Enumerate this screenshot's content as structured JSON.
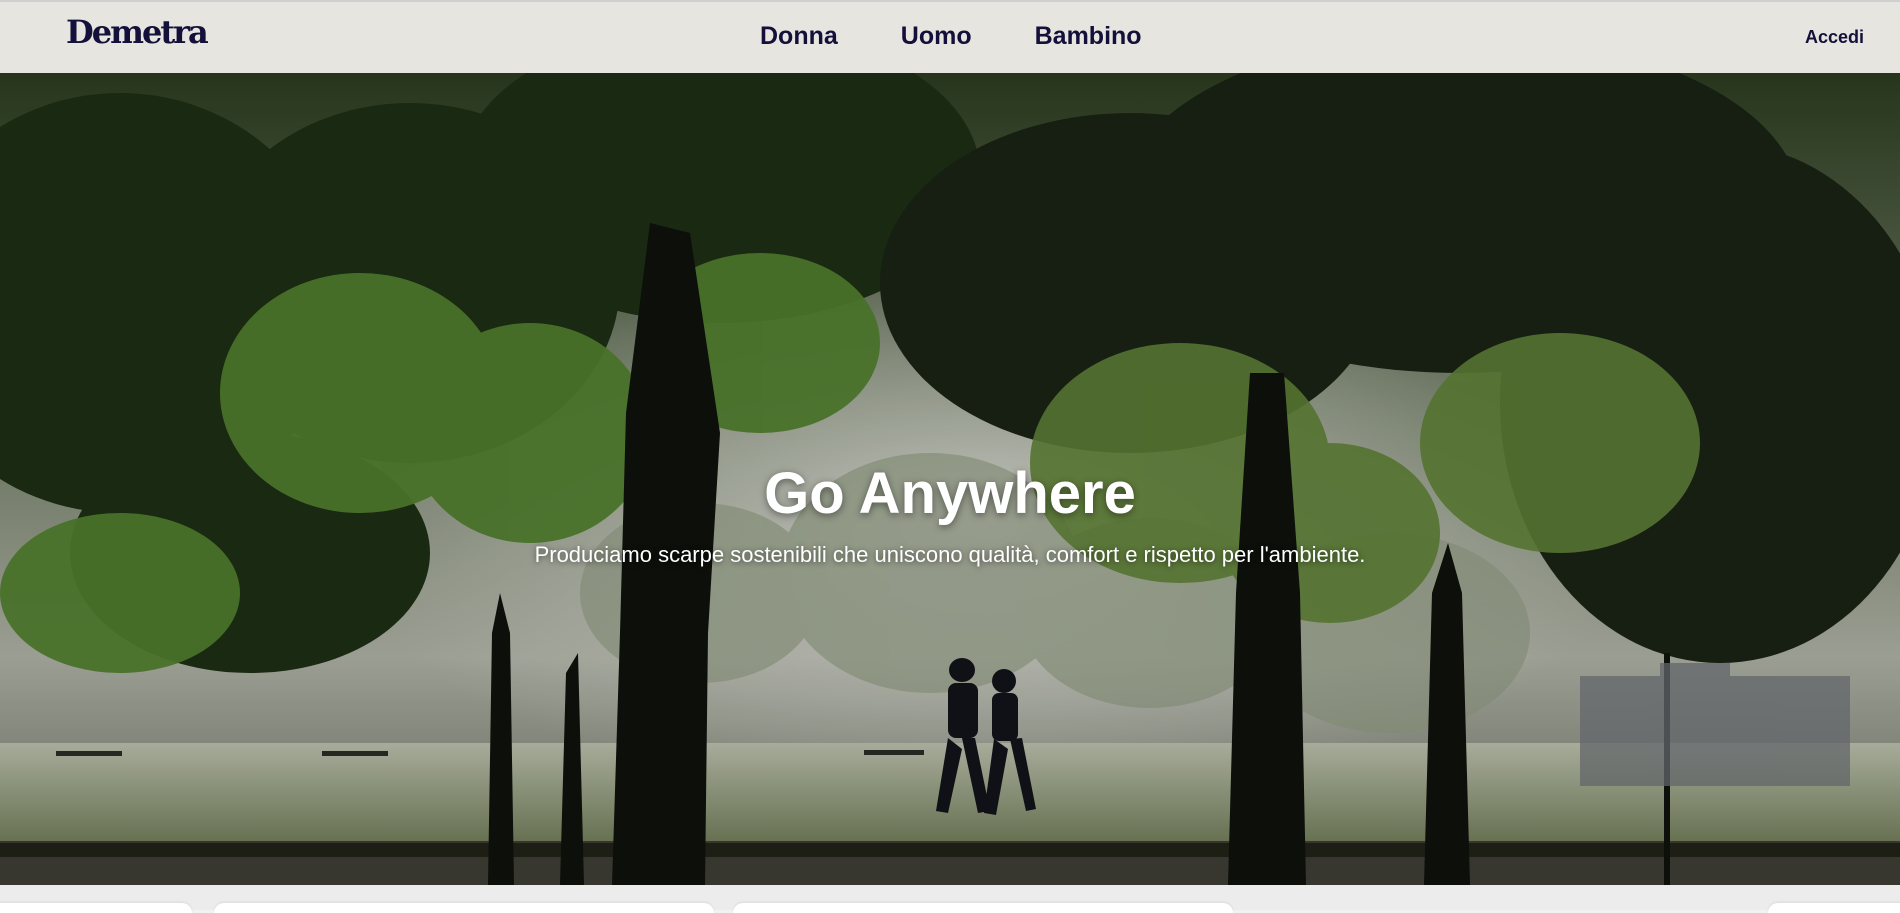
{
  "header": {
    "logo": "Demetra",
    "nav": [
      {
        "label": "Donna"
      },
      {
        "label": "Uomo"
      },
      {
        "label": "Bambino"
      }
    ],
    "login_label": "Accedi"
  },
  "hero": {
    "title": "Go Anywhere",
    "subtitle": "Produciamo scarpe sostenibili che uniscono qualità, comfort e rispetto per l'ambiente."
  },
  "colors": {
    "header_bg": "#e6e5e0",
    "brand_text": "#131039",
    "hero_text": "#ffffff"
  }
}
